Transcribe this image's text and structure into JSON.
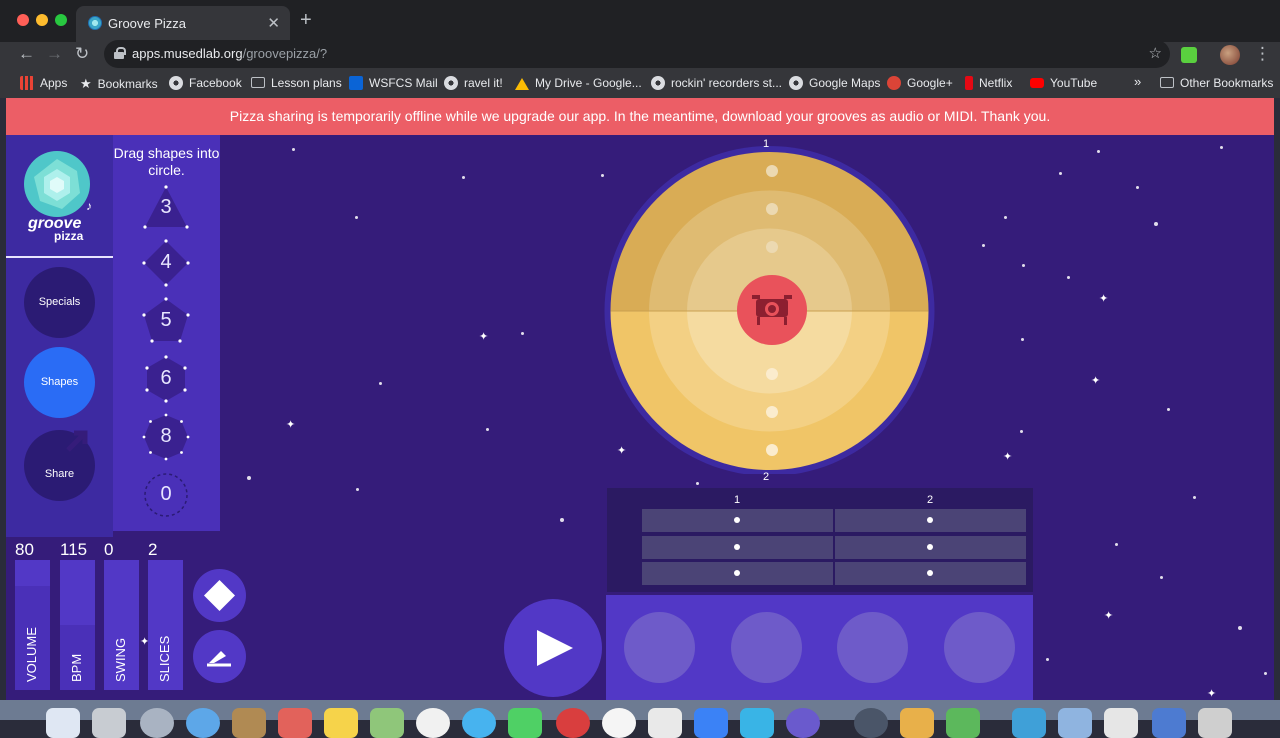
{
  "browser": {
    "tab_title": "Groove Pizza",
    "tab_close": "✕",
    "new_tab": "+",
    "url_host": "apps.musedlab.org",
    "url_path": "/groovepizza/?",
    "bookmarks": [
      {
        "label": "Apps",
        "icon": "apps-grid-icon",
        "color": "#ea4335"
      },
      {
        "label": "Bookmarks",
        "icon": "star-icon",
        "color": "#e8eaed"
      },
      {
        "label": "Facebook",
        "icon": "chrome-globe-icon",
        "color": "#dadce0"
      },
      {
        "label": "Lesson plans",
        "icon": "folder-icon",
        "color": "#bdc1c6"
      },
      {
        "label": "WSFCS Mail",
        "icon": "outlook-icon",
        "color": "#0a64d6"
      },
      {
        "label": "ravel it!",
        "icon": "chrome-globe-icon",
        "color": "#dadce0"
      },
      {
        "label": "My Drive - Google...",
        "icon": "google-drive-icon",
        "color": "#fbbc04"
      },
      {
        "label": "rockin' recorders st...",
        "icon": "chrome-globe-icon",
        "color": "#dadce0"
      },
      {
        "label": "Google Maps",
        "icon": "chrome-globe-icon",
        "color": "#dadce0"
      },
      {
        "label": "Google+",
        "icon": "google-plus-icon",
        "color": "#db4437"
      },
      {
        "label": "Netflix",
        "icon": "netflix-icon",
        "color": "#e50914"
      },
      {
        "label": "YouTube",
        "icon": "youtube-icon",
        "color": "#ff0000"
      }
    ],
    "bookmarks_overflow": "»",
    "other_bookmarks": "Other Bookmarks"
  },
  "app": {
    "banner": "Pizza sharing is temporarily offline while we upgrade our app. In the meantime, download your grooves as audio or MIDI. Thank you.",
    "logo_line1": "groove",
    "logo_line2": "pizza",
    "menu": {
      "specials": "Specials",
      "shapes": "Shapes",
      "share": "Share"
    },
    "shape_instructions": "Drag shapes into circle.",
    "shapes": [
      "3",
      "4",
      "5",
      "6",
      "8",
      "0"
    ],
    "sliders": [
      {
        "label": "VOLUME",
        "value": "80",
        "level": 0.8
      },
      {
        "label": "BPM",
        "value": "115",
        "level": 0.5
      },
      {
        "label": "SWING",
        "value": "0",
        "level": 0
      },
      {
        "label": "SLICES",
        "value": "2",
        "level": 0
      }
    ],
    "pizza": {
      "top_label": "1",
      "bottom_label": "2"
    },
    "grid": {
      "columns": [
        "1",
        "2"
      ]
    },
    "colors": {
      "background": "#351c7a",
      "banner": "#ec5e66",
      "accent_blue": "#2a6cf5",
      "pizza_center": "#e9525b"
    }
  }
}
